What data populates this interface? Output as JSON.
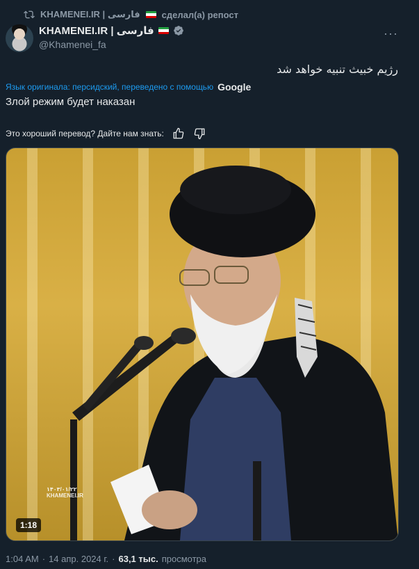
{
  "repost": {
    "account_name": "KHAMENEI.IR | فارسی",
    "action": "сделал(а) репост",
    "icon": "repost-icon"
  },
  "author": {
    "name": "KHAMENEI.IR | فارسی",
    "handle": "@Khamenei_fa",
    "flag": "iran-flag",
    "verified_icon": "verified-badge-icon",
    "verified_color": "#8b98a5"
  },
  "tweet": {
    "original_text": "رژیم خبیث تنبیه خواهد شد",
    "translation_note": "Язык оригинала: персидский, переведено с помощью",
    "translation_provider": "Google",
    "translated_text": "Злой режим будет наказан",
    "feedback_prompt": "Это хороший перевод? Дайте нам знать:"
  },
  "media": {
    "duration": "1:18",
    "watermark_date": "۱۴۰۳/۰۱/۲۲",
    "watermark_site": "KHAMENEI.IR"
  },
  "footer": {
    "time": "1:04 AM",
    "separator": "·",
    "date": "14 апр. 2024 г.",
    "views_count": "63,1 тыс.",
    "views_label": "просмотра"
  },
  "colors": {
    "background": "#15202b",
    "link": "#1d9bf0",
    "muted": "#8b98a5"
  }
}
